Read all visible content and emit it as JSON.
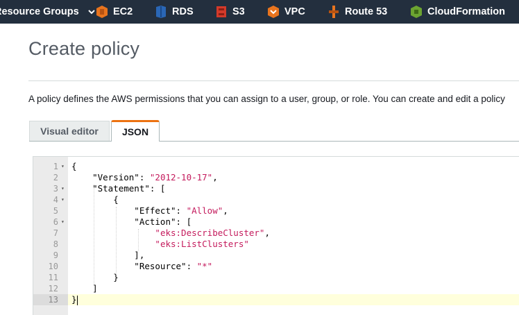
{
  "nav": {
    "resource_groups": "Resource Groups",
    "services": [
      {
        "key": "ec2",
        "label": "EC2",
        "icon": "ec2-icon",
        "color": "#e8741e"
      },
      {
        "key": "rds",
        "label": "RDS",
        "icon": "rds-icon",
        "color": "#2a67b6"
      },
      {
        "key": "s3",
        "label": "S3",
        "icon": "s3-icon",
        "color": "#d33a2a"
      },
      {
        "key": "vpc",
        "label": "VPC",
        "icon": "vpc-icon",
        "color": "#e8741e"
      },
      {
        "key": "route53",
        "label": "Route 53",
        "icon": "route53-icon",
        "color": "#e8741e"
      },
      {
        "key": "cloudformation",
        "label": "CloudFormation",
        "icon": "cloudformation-icon",
        "color": "#6ca431"
      }
    ]
  },
  "page": {
    "title": "Create policy",
    "intro": "A policy defines the AWS permissions that you can assign to a user, group, or role. You can create and edit a policy"
  },
  "tabs": [
    {
      "label": "Visual editor",
      "active": false
    },
    {
      "label": "JSON",
      "active": true
    }
  ],
  "editor": {
    "active_line": 13,
    "lines": [
      {
        "num": "1",
        "fold": true,
        "parts": [
          [
            "p",
            "{"
          ]
        ]
      },
      {
        "num": "2",
        "fold": false,
        "parts": [
          [
            "p",
            "    \"Version\": "
          ],
          [
            "s",
            "\"2012-10-17\""
          ],
          [
            "p",
            ","
          ]
        ]
      },
      {
        "num": "3",
        "fold": true,
        "parts": [
          [
            "p",
            "    \"Statement\": ["
          ]
        ]
      },
      {
        "num": "4",
        "fold": true,
        "parts": [
          [
            "p",
            "        {"
          ]
        ]
      },
      {
        "num": "5",
        "fold": false,
        "parts": [
          [
            "p",
            "            \"Effect\": "
          ],
          [
            "s",
            "\"Allow\""
          ],
          [
            "p",
            ","
          ]
        ]
      },
      {
        "num": "6",
        "fold": true,
        "parts": [
          [
            "p",
            "            \"Action\": ["
          ]
        ]
      },
      {
        "num": "7",
        "fold": false,
        "parts": [
          [
            "p",
            "                "
          ],
          [
            "s",
            "\"eks:DescribeCluster\""
          ],
          [
            "p",
            ","
          ]
        ]
      },
      {
        "num": "8",
        "fold": false,
        "parts": [
          [
            "p",
            "                "
          ],
          [
            "s",
            "\"eks:ListClusters\""
          ]
        ]
      },
      {
        "num": "9",
        "fold": false,
        "parts": [
          [
            "p",
            "            ],"
          ]
        ]
      },
      {
        "num": "10",
        "fold": false,
        "parts": [
          [
            "p",
            "            \"Resource\": "
          ],
          [
            "s",
            "\"*\""
          ]
        ]
      },
      {
        "num": "11",
        "fold": false,
        "parts": [
          [
            "p",
            "        }"
          ]
        ]
      },
      {
        "num": "12",
        "fold": false,
        "parts": [
          [
            "p",
            "    ]"
          ]
        ]
      },
      {
        "num": "13",
        "fold": false,
        "parts": [
          [
            "p",
            "}"
          ]
        ]
      }
    ]
  }
}
